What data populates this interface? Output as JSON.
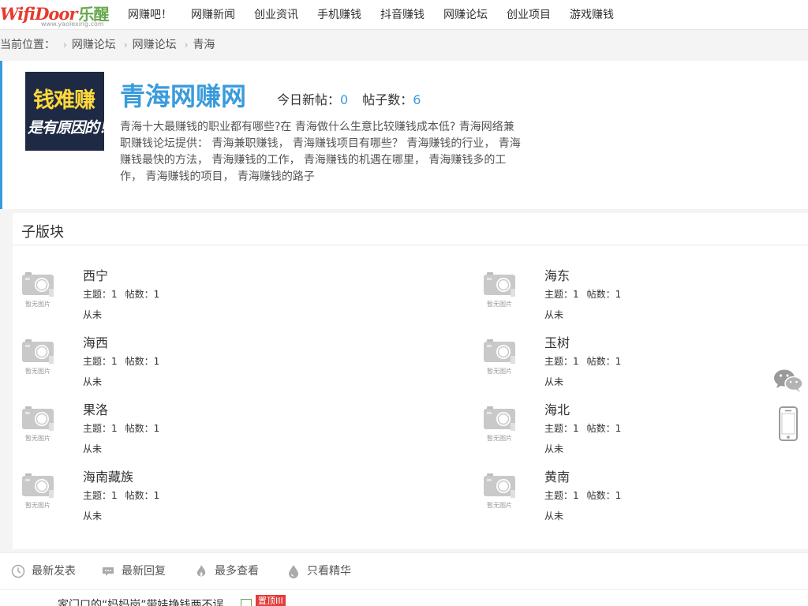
{
  "logo": {
    "wordmark": "WifiDoor",
    "cn": "乐醒",
    "site": "www.yaolexing.com"
  },
  "nav": {
    "items": [
      {
        "label": "网赚吧！"
      },
      {
        "label": "网赚新闻"
      },
      {
        "label": "创业资讯"
      },
      {
        "label": "手机赚钱"
      },
      {
        "label": "抖音赚钱"
      },
      {
        "label": "网赚论坛"
      },
      {
        "label": "创业项目"
      },
      {
        "label": "游戏赚钱"
      }
    ]
  },
  "breadcrumb": {
    "prefix": "当前位置：",
    "items": [
      {
        "label": "网赚论坛"
      },
      {
        "label": "网赚论坛"
      },
      {
        "label": "青海"
      }
    ]
  },
  "forum": {
    "cover_line1": "钱难赚",
    "cover_line2": "是有原因的！",
    "title": "青海网赚网",
    "today_label": "今日新帖：",
    "today_value": "0",
    "posts_label": "帖子数：",
    "posts_value": "6",
    "description": "青海十大最赚钱的职业都有哪些?在 青海做什么生意比较赚钱成本低? 青海网络兼职赚钱论坛提供： 青海兼职赚钱， 青海赚钱项目有哪些？ 青海赚钱的行业， 青海赚钱最快的方法， 青海赚钱的工作， 青海赚钱的机遇在哪里， 青海赚钱多的工作， 青海赚钱的项目， 青海赚钱的路子"
  },
  "subforums": {
    "heading": "子版块",
    "no_image_label": "暂无图片",
    "items": [
      {
        "name": "西宁",
        "topics_label": "主题：",
        "topics": "1",
        "posts_label": "帖数：",
        "posts": "1",
        "last": "从未"
      },
      {
        "name": "海东",
        "topics_label": "主题：",
        "topics": "1",
        "posts_label": "帖数：",
        "posts": "1",
        "last": "从未"
      },
      {
        "name": "海西",
        "topics_label": "主题：",
        "topics": "1",
        "posts_label": "帖数：",
        "posts": "1",
        "last": "从未"
      },
      {
        "name": "玉树",
        "topics_label": "主题：",
        "topics": "1",
        "posts_label": "帖数：",
        "posts": "1",
        "last": "从未"
      },
      {
        "name": "果洛",
        "topics_label": "主题：",
        "topics": "1",
        "posts_label": "帖数：",
        "posts": "1",
        "last": "从未"
      },
      {
        "name": "海北",
        "topics_label": "主题：",
        "topics": "1",
        "posts_label": "帖数：",
        "posts": "1",
        "last": "从未"
      },
      {
        "name": "海南藏族",
        "topics_label": "主题：",
        "topics": "1",
        "posts_label": "帖数：",
        "posts": "1",
        "last": "从未"
      },
      {
        "name": "黄南",
        "topics_label": "主题：",
        "topics": "1",
        "posts_label": "帖数：",
        "posts": "1",
        "last": "从未"
      }
    ]
  },
  "filters": {
    "items": [
      {
        "label": "最新发表",
        "icon": "clock-icon"
      },
      {
        "label": "最新回复",
        "icon": "comment-icon"
      },
      {
        "label": "最多查看",
        "icon": "flame-icon"
      },
      {
        "label": "只看精华",
        "icon": "drop-icon"
      }
    ]
  },
  "thread_partial": {
    "title": "家门口的“妈妈岗”带娃挣钱两不误",
    "badge": "置顶III"
  },
  "side": {
    "icons": [
      "wechat-icon",
      "mobile-icon"
    ]
  },
  "colors": {
    "accent": "#3a9bdc",
    "badge": "#e23c3c",
    "logo_red": "#e63b2e",
    "logo_green": "#6aa84f"
  }
}
